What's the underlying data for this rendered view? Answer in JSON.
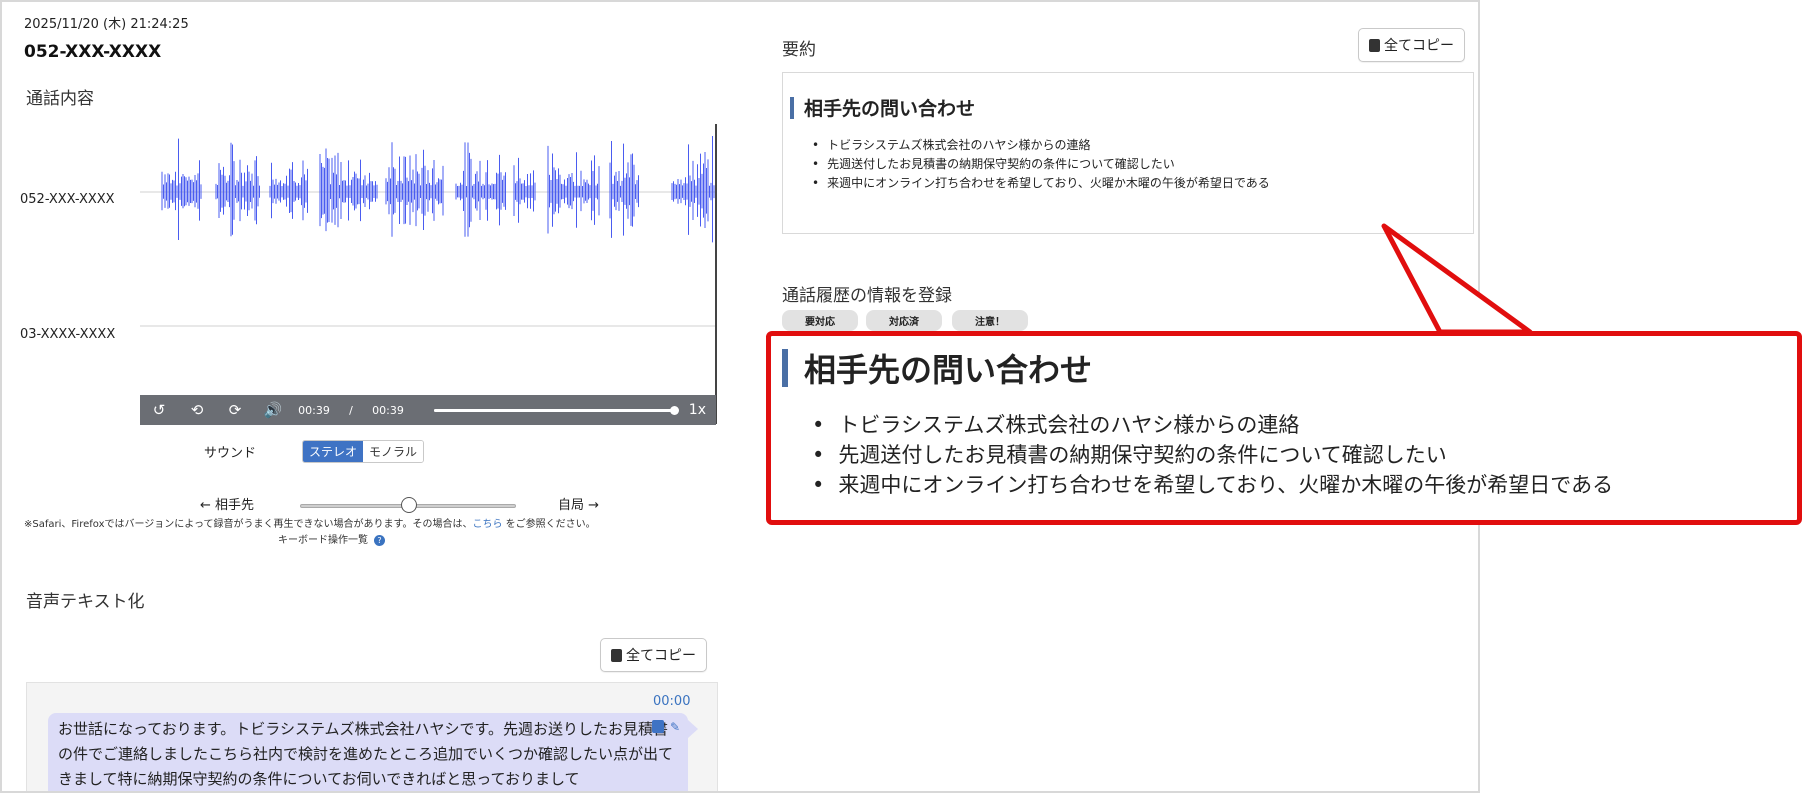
{
  "left": {
    "datetime": "2025/11/20 (木) 21:24:25",
    "phone": "052-XXX-XXXX",
    "call_content_label": "通話内容",
    "tracks": [
      "052-XXX-XXXX",
      "03-XXXX-XXXX"
    ],
    "player": {
      "current_time": "00:39",
      "separator": "/",
      "duration": "00:39",
      "speed": "1x",
      "progress": 1.0
    },
    "sound": {
      "label": "サウンド",
      "options": [
        "ステレオ",
        "モノラル"
      ],
      "selected": "ステレオ"
    },
    "balance": {
      "left": "← 相手先",
      "right": "自局 →",
      "value": 0.5
    },
    "note_prefix": "※Safari、Firefoxではバージョンによって録音がうまく再生できない場合があります。その場合は、",
    "note_link": "こちら",
    "note_suffix": " をご参照ください。",
    "keyboard_label": "キーボード操作一覧",
    "keyboard_help_icon": "?",
    "transcription_label": "音声テキスト化",
    "copy_all_label": "全てコピー",
    "transcript": {
      "timestamp": "00:00",
      "text": "お世話になっております。トビラシステムズ株式会社ハヤシです。先週お送りしたお見積書の件でご連絡しましたこちら社内で検討を進めたところ追加でいくつか確認したい点が出てきまして特に納期保守契約の条件についてお伺いできればと思っておりまして"
    }
  },
  "right": {
    "summary_label": "要約",
    "copy_all_label": "全てコピー",
    "summary": {
      "heading": "相手先の問い合わせ",
      "items": [
        "トビラシステムズ株式会社のハヤシ様からの連絡",
        "先週送付したお見積書の納期保守契約の条件について確認したい",
        "来週中にオンライン打ち合わせを希望しており、火曜か木曜の午後が希望日である"
      ]
    },
    "register_label": "通話履歴の情報を登録",
    "tags": [
      "要対応",
      "対応済",
      "注意！"
    ]
  },
  "callout": {
    "heading": "相手先の問い合わせ",
    "items": [
      "トビラシステムズ株式会社のハヤシ様からの連絡",
      "先週送付したお見積書の納期保守契約の条件について確認したい",
      "来週中にオンライン打ち合わせを希望しており、火曜か木曜の午後が希望日である"
    ],
    "border_color": "#e10e0e"
  },
  "colors": {
    "waveform": "#4a5cf0",
    "accent": "#3f73c4",
    "link": "#3a73c0",
    "bubble": "#dcdcf7",
    "heading_bar": "#4a6fa5"
  }
}
